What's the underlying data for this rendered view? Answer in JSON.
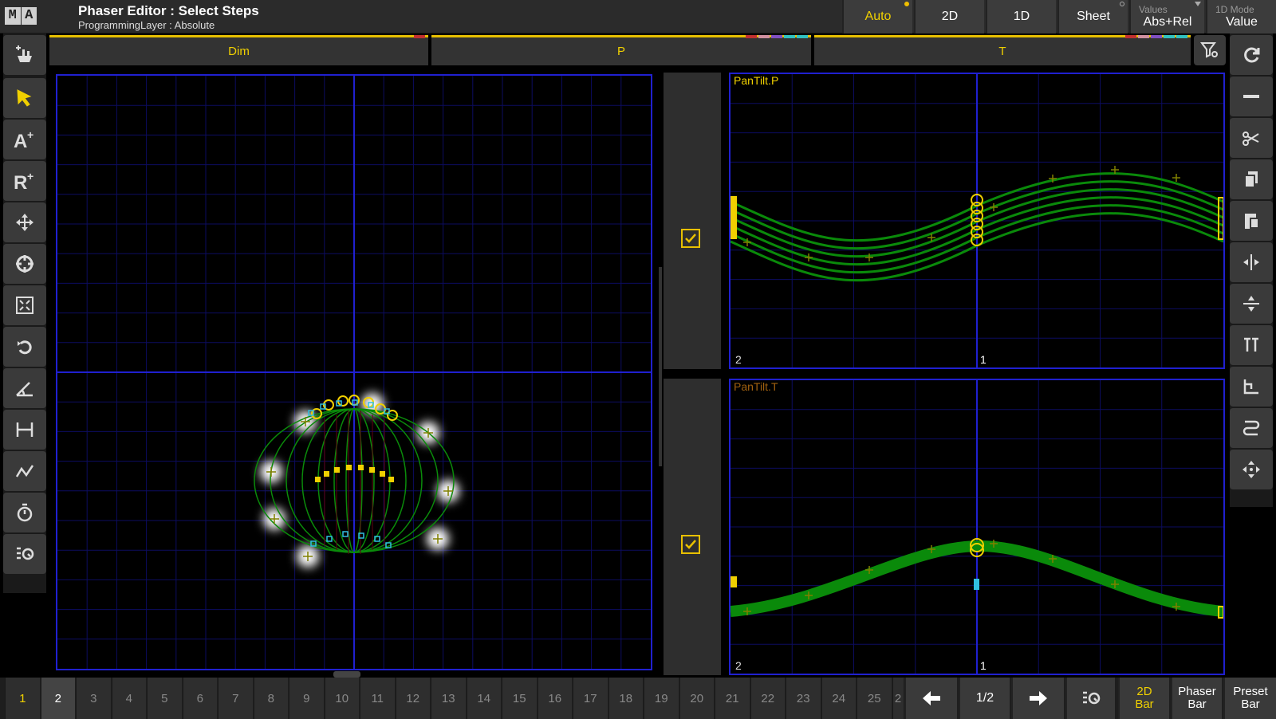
{
  "app": {
    "logo_left": "M",
    "logo_right": "A"
  },
  "title": {
    "main": "Phaser Editor : Select Steps",
    "sub": "ProgrammingLayer : Absolute"
  },
  "modes": [
    {
      "label": "Auto",
      "active": true
    },
    {
      "label": "2D",
      "active": false
    },
    {
      "label": "1D",
      "active": false
    },
    {
      "label": "Sheet",
      "active": false
    }
  ],
  "values_btn": {
    "label": "Values",
    "value": "Abs+Rel"
  },
  "mode1d_btn": {
    "label": "1D Mode",
    "value": "Value"
  },
  "columns": [
    "Dim",
    "P",
    "T"
  ],
  "graphs": {
    "pan": {
      "label": "PanTilt.P",
      "left_num": "2",
      "center_num": "1"
    },
    "tilt": {
      "label": "PanTilt.T",
      "left_num": "2",
      "center_num": "1"
    }
  },
  "steps": [
    "1",
    "2",
    "3",
    "4",
    "5",
    "6",
    "7",
    "8",
    "9",
    "10",
    "11",
    "12",
    "13",
    "14",
    "15",
    "16",
    "17",
    "18",
    "19",
    "20",
    "21",
    "22",
    "23",
    "24",
    "25",
    "2"
  ],
  "current_step": "1",
  "selected_step": "2",
  "page_indicator": "1/2",
  "bar_buttons": [
    {
      "line1": "2D",
      "line2": "Bar",
      "active": true
    },
    {
      "line1": "Phaser",
      "line2": "Bar",
      "active": false
    },
    {
      "line1": "Preset",
      "line2": "Bar",
      "active": false
    }
  ],
  "colors": {
    "accent": "#f0d000",
    "grid_blue": "#2020d0",
    "curve_green": "#0a8a0a"
  }
}
